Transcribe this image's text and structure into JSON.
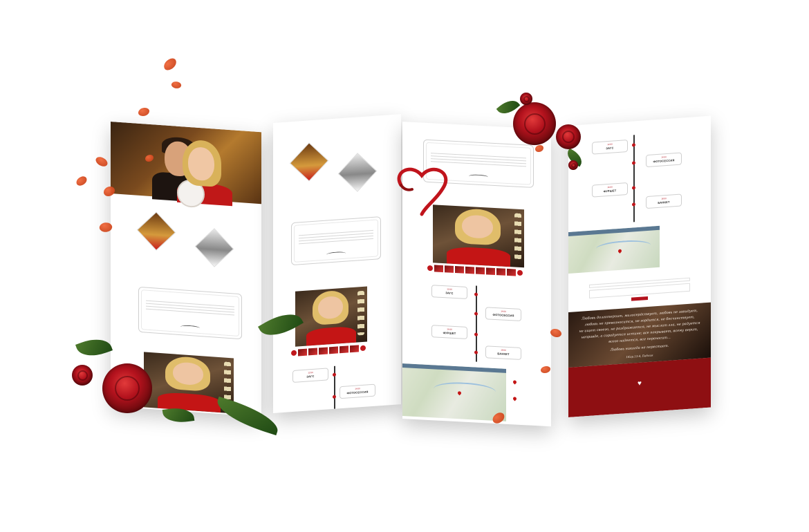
{
  "colors": {
    "accent_red": "#b3121d",
    "footer_red": "#8e0f12",
    "petal_orange": "#e4582a",
    "map_header": "#5a7892"
  },
  "panel1": {
    "nav_items": [
      "",
      "",
      "",
      "",
      "",
      ""
    ],
    "section_label": "",
    "couple_names": "",
    "quote_signature": ""
  },
  "panel2": {
    "names": "",
    "frame_caption": ""
  },
  "panel3": {
    "events": [
      {
        "time": "12:00",
        "name": "ЗАГС"
      },
      {
        "time": "14:00",
        "name": "ФОТОСЕССИЯ"
      },
      {
        "time": "16:00",
        "name": "ФУРШЕТ"
      },
      {
        "time": "18:00",
        "name": "БАНКЕТ"
      }
    ]
  },
  "panel4": {
    "events": [
      {
        "time": "12:00",
        "name": "ЗАГС"
      },
      {
        "time": "14:00",
        "name": "ФОТОСЕССИЯ"
      },
      {
        "time": "16:00",
        "name": "ФУРШЕТ"
      },
      {
        "time": "18:00",
        "name": "БАНКЕТ"
      }
    ],
    "quote_lines": [
      "Любовь долготерпит, милосердствует, любовь не завидует,",
      "любовь не превозносится, не гордится, не бесчинствует,",
      "не ищет своего, не раздражается, не мыслит зла, не радуется",
      "неправде, а сорадуется истине; все покрывает, всему верит,",
      "всего надеется, все переносит...",
      "Любовь никогда не перестает."
    ],
    "quote_source": "1Кор.13:4, Библия"
  }
}
